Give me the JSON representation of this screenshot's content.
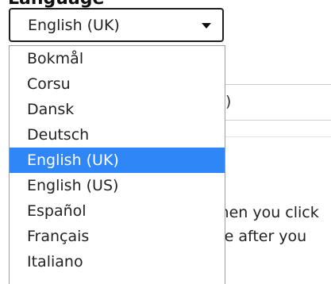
{
  "heading": "Language",
  "select": {
    "value": "English (UK)"
  },
  "options": [
    {
      "label": "Bokmål",
      "selected": false
    },
    {
      "label": "Corsu",
      "selected": false
    },
    {
      "label": "Dansk",
      "selected": false
    },
    {
      "label": "Deutsch",
      "selected": false
    },
    {
      "label": "English (UK)",
      "selected": true
    },
    {
      "label": "English (US)",
      "selected": false
    },
    {
      "label": "Español",
      "selected": false
    },
    {
      "label": "Français",
      "selected": false
    },
    {
      "label": "Italiano",
      "selected": false
    }
  ],
  "background": {
    "field_fragment": ")",
    "line1": "when you click",
    "line2": "see after you"
  },
  "colors": {
    "accent": "#2f86f6"
  }
}
